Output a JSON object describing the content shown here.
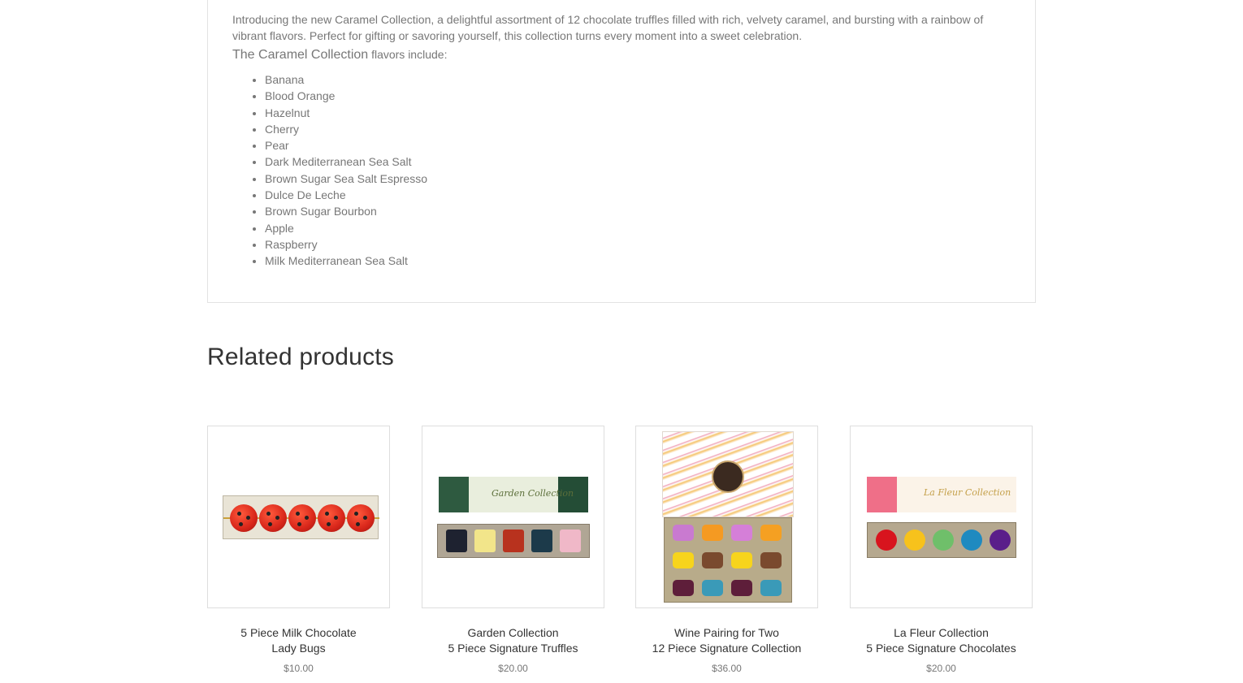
{
  "description": {
    "intro": "Introducing the new Caramel Collection, a delightful assortment of 12 chocolate truffles filled with rich, velvety caramel, and bursting with a rainbow of vibrant flavors. Perfect for gifting or savoring yourself, this collection turns every moment into a sweet celebration.",
    "flavors_heading_strong": "The Caramel Collection",
    "flavors_heading_rest": " flavors include:",
    "flavors": [
      "Banana",
      "Blood Orange",
      "Hazelnut",
      "Cherry",
      "Pear",
      "Dark Mediterranean Sea Salt",
      "Brown Sugar Sea Salt Espresso",
      "Dulce De Leche",
      "Brown Sugar Bourbon",
      "Apple",
      "Raspberry",
      "Milk Mediterranean Sea Salt"
    ]
  },
  "related": {
    "title": "Related products",
    "products": [
      {
        "name_line1": "5 Piece Milk Chocolate",
        "name_line2": "Lady Bugs",
        "price": "$10.00"
      },
      {
        "name_line1": "Garden Collection",
        "name_line2": "5 Piece Signature Truffles",
        "price": "$20.00",
        "box_label": "Garden Collection"
      },
      {
        "name_line1": "Wine Pairing for Two",
        "name_line2": "12 Piece Signature Collection",
        "price": "$36.00"
      },
      {
        "name_line1": "La Fleur Collection",
        "name_line2": "5 Piece Signature Chocolates",
        "price": "$20.00",
        "box_label": "La Fleur Collection"
      }
    ]
  }
}
